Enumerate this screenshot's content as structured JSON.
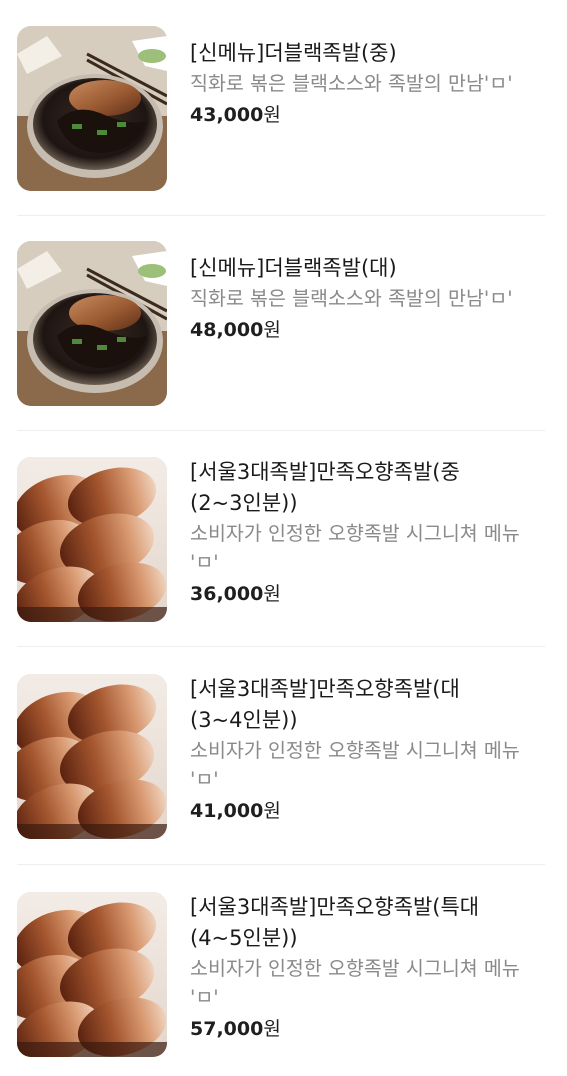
{
  "items": [
    {
      "title": "[신메뉴]더블랙족발(중)",
      "description": "직화로 볶은 블랙소스와 족발의 만남'ㅁ'",
      "price": "43,000",
      "price_unit": "원",
      "image": "black-jokbal-photo"
    },
    {
      "title": "[신메뉴]더블랙족발(대)",
      "description": "직화로 볶은 블랙소스와 족발의 만남'ㅁ'",
      "price": "48,000",
      "price_unit": "원",
      "image": "black-jokbal-photo"
    },
    {
      "title": "[서울3대족발]만족오향족발(중(2~3인분))",
      "description": "소비자가 인정한 오향족발 시그니쳐 메뉴 'ㅁ'",
      "price": "36,000",
      "price_unit": "원",
      "image": "ohyang-jokbal-photo"
    },
    {
      "title": "[서울3대족발]만족오향족발(대(3~4인분))",
      "description": "소비자가 인정한 오향족발 시그니쳐 메뉴 'ㅁ'",
      "price": "41,000",
      "price_unit": "원",
      "image": "ohyang-jokbal-photo"
    },
    {
      "title": "[서울3대족발]만족오향족발(특대(4~5인분))",
      "description": "소비자가 인정한 오향족발 시그니쳐 메뉴 'ㅁ'",
      "price": "57,000",
      "price_unit": "원",
      "image": "ohyang-jokbal-photo"
    }
  ]
}
